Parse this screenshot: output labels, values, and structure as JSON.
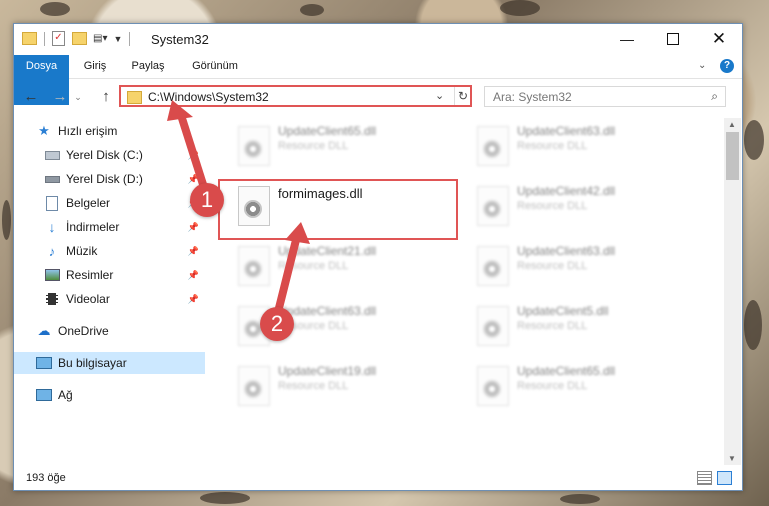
{
  "window": {
    "title": "System32"
  },
  "ribbon": {
    "tabs": [
      "Dosya",
      "Giriş",
      "Paylaş",
      "Görünüm"
    ]
  },
  "address": {
    "path": "C:\\Windows\\System32"
  },
  "search": {
    "placeholder": "Ara: System32"
  },
  "sidebar": {
    "items": [
      {
        "label": "Hızlı erişim",
        "icon": "star-icon"
      },
      {
        "label": "Yerel Disk (C:)",
        "icon": "disk-icon"
      },
      {
        "label": "Yerel Disk (D:)",
        "icon": "disk-icon"
      },
      {
        "label": "Belgeler",
        "icon": "documents-icon"
      },
      {
        "label": "İndirmeler",
        "icon": "download-icon"
      },
      {
        "label": "Müzik",
        "icon": "music-icon"
      },
      {
        "label": "Resimler",
        "icon": "pictures-icon"
      },
      {
        "label": "Videolar",
        "icon": "videos-icon"
      },
      {
        "label": "OneDrive",
        "icon": "cloud-icon"
      },
      {
        "label": "Bu bilgisayar",
        "icon": "computer-icon"
      },
      {
        "label": "Ağ",
        "icon": "network-icon"
      }
    ]
  },
  "files": [
    {
      "name": "UpdateClient65.dll",
      "type": "Resource DLL"
    },
    {
      "name": "UpdateClient63.dll",
      "type": "Resource DLL"
    },
    {
      "name": "formimages.dll",
      "type": ""
    },
    {
      "name": "UpdateClient42.dll",
      "type": "Resource DLL"
    },
    {
      "name": "UpdateClient21.dll",
      "type": "Resource DLL"
    },
    {
      "name": "UpdateClient63.dll",
      "type": "Resource DLL"
    },
    {
      "name": "UpdateClient63.dll",
      "type": "Resource DLL"
    },
    {
      "name": "UpdateClient5.dll",
      "type": "Resource DLL"
    },
    {
      "name": "UpdateClient19.dll",
      "type": "Resource DLL"
    },
    {
      "name": "UpdateClient65.dll",
      "type": "Resource DLL"
    }
  ],
  "status": {
    "count": "193 öğe"
  },
  "annotations": {
    "badge1": "1",
    "badge2": "2"
  },
  "colors": {
    "accent": "#1979ca",
    "highlight": "#e05555",
    "selected": "#cce8ff"
  }
}
